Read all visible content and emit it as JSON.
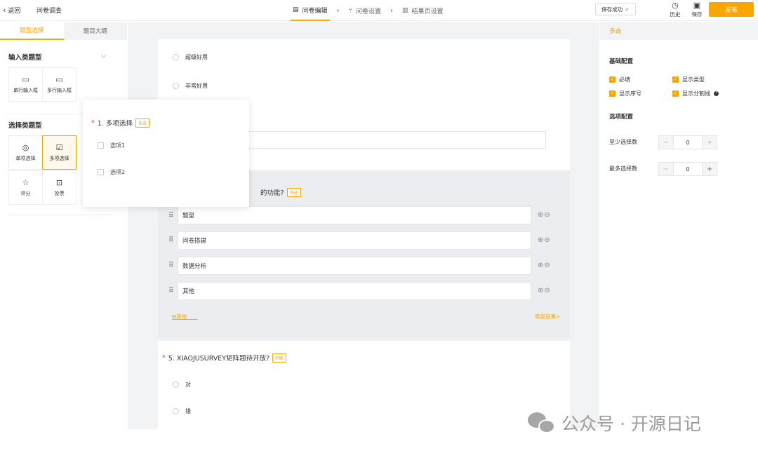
{
  "header": {
    "back_label": "返回",
    "page_name": "问卷调查",
    "steps": [
      {
        "label": "问卷编辑",
        "active": true
      },
      {
        "label": "问卷设置",
        "active": false
      },
      {
        "label": "结果页设置",
        "active": false
      }
    ],
    "save_status": "保存成功",
    "history_label": "历史",
    "save_label": "保存",
    "publish_label": "发布"
  },
  "left": {
    "tabs": [
      "题型选择",
      "题目大纲"
    ],
    "input_section": "输入类题型",
    "input_types": [
      "单行输入框",
      "多行输入框"
    ],
    "choice_section": "选择类题型",
    "choice_types": [
      "单项选择",
      "多项选择",
      "评分",
      "投票"
    ]
  },
  "main": {
    "options_top": [
      "超级好用",
      "非常好用"
    ],
    "q4_title_tail": "的功能?",
    "q4_tag": "多选",
    "q4_options": [
      "题型",
      "问卷搭建",
      "数据分析",
      "其他"
    ],
    "other_link": "其他____",
    "advanced_link": "高级设置>",
    "q5_title": "5. XIAOJUSURVEY矩阵题待开放?",
    "q5_tag": "判断",
    "q5_options": [
      "对",
      "错"
    ]
  },
  "popup": {
    "title": "1.  多项选择",
    "tag": "多选",
    "options": [
      "选项1",
      "选项2"
    ]
  },
  "right": {
    "header": "多选",
    "basic_title": "基础配置",
    "checkboxes": [
      "必填",
      "显示类型",
      "显示序号",
      "显示分割线"
    ],
    "option_title": "选项配置",
    "min_label": "至少选择数",
    "min_value": "0",
    "max_label": "最多选择数",
    "max_value": "0"
  },
  "watermark": "公众号 · 开源日记"
}
